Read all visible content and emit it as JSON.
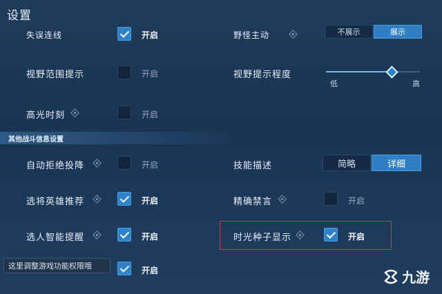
{
  "header": {
    "title": "设置"
  },
  "rows_left": [
    {
      "label": "失误连线",
      "checked": true,
      "state": "开启",
      "has_info": false
    },
    {
      "label": "视野范围提示",
      "checked": false,
      "state": "开启",
      "has_info": false
    },
    {
      "label": "高光时刻",
      "checked": false,
      "state": "开启",
      "has_info": true
    }
  ],
  "section": {
    "title": "其他战斗信息设置"
  },
  "rows_left_2": [
    {
      "label": "自动拒绝投降",
      "checked": false,
      "state": "开启",
      "has_info": true
    },
    {
      "label": "选将英雄推荐",
      "checked": true,
      "state": "开启",
      "has_info": true
    },
    {
      "label": "选人智能提醒",
      "checked": true,
      "state": "开启",
      "has_info": true
    },
    {
      "label": "",
      "checked": true,
      "state": "开启",
      "has_info": false
    }
  ],
  "rows_right": {
    "top_cut": {
      "label": "野怪主动",
      "options": [
        "不展示",
        "展示"
      ],
      "selected": 1
    },
    "vision_slider": {
      "label": "视野提示程度",
      "min_label": "低",
      "max_label": "高",
      "value_fraction": 0.7
    },
    "skill_desc": {
      "label": "技能描述",
      "options": [
        "简略",
        "详细"
      ],
      "selected": 1
    },
    "precise_ban": {
      "label": "精确禁言",
      "checked": false,
      "state": "开启",
      "has_info": true
    },
    "time_seed": {
      "label": "时光种子显示",
      "checked": true,
      "state": "开启",
      "has_info": true
    }
  },
  "tooltip": {
    "text": "这里调整游戏功能权限哦"
  },
  "watermark": {
    "text": "九游"
  },
  "colors": {
    "accent": "#2f82c8",
    "highlight": "#d23a3a",
    "background": "#1d3858"
  }
}
